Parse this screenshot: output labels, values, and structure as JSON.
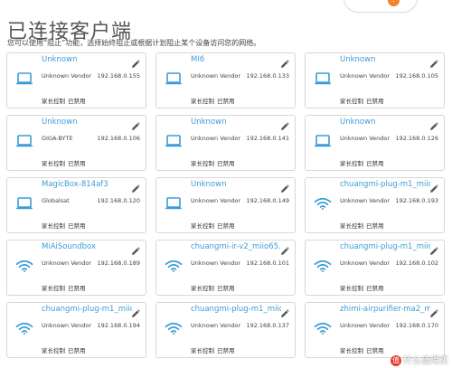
{
  "header": {
    "title": "已连接客户端",
    "notification_count": "!"
  },
  "description": "您可以使用“阻止”功能，选择始终阻止或根据计划阻止某个设备访问您的网络。",
  "labels": {
    "parental_control": "家长控制",
    "disabled": "已禁用"
  },
  "devices": [
    {
      "name": "Unknown",
      "vendor": "Unknown Vendor",
      "ip": "192.168.0.155",
      "type": "wired"
    },
    {
      "name": "MI6",
      "vendor": "Unknown Vendor",
      "ip": "192.168.0.133",
      "type": "wired"
    },
    {
      "name": "Unknown",
      "vendor": "Unknown Vendor",
      "ip": "192.168.0.105",
      "type": "wired"
    },
    {
      "name": "Unknown",
      "vendor": "GIGA-BYTE",
      "ip": "192.168.0.106",
      "type": "wired"
    },
    {
      "name": "Unknown",
      "vendor": "Unknown Vendor",
      "ip": "192.168.0.141",
      "type": "wired"
    },
    {
      "name": "Unknown",
      "vendor": "Unknown Vendor",
      "ip": "192.168.0.126",
      "type": "wired"
    },
    {
      "name": "MagicBox-814af3",
      "vendor": "Globalsat",
      "ip": "192.168.0.120",
      "type": "wired"
    },
    {
      "name": "Unknown",
      "vendor": "Unknown Vendor",
      "ip": "192.168.0.149",
      "type": "wired"
    },
    {
      "name": "chuangmi-plug-m1_miio...",
      "vendor": "Unknown Vendor",
      "ip": "192.168.0.193",
      "type": "wifi"
    },
    {
      "name": "MiAiSoundbox",
      "vendor": "Unknown Vendor",
      "ip": "192.168.0.189",
      "type": "wifi"
    },
    {
      "name": "chuangmi-ir-v2_miio65...",
      "vendor": "Unknown Vendor",
      "ip": "192.168.0.101",
      "type": "wifi"
    },
    {
      "name": "chuangmi-plug-m1_miio...",
      "vendor": "Unknown Vendor",
      "ip": "192.168.0.102",
      "type": "wifi"
    },
    {
      "name": "chuangmi-plug-m1_miio...",
      "vendor": "Unknown Vendor",
      "ip": "192.168.0.194",
      "type": "wifi"
    },
    {
      "name": "chuangmi-plug-m1_miio...",
      "vendor": "Unknown Vendor",
      "ip": "192.168.0.137",
      "type": "wifi"
    },
    {
      "name": "zhimi-airpurifier-ma2_m...",
      "vendor": "Unknown Vendor",
      "ip": "192.168.0.170",
      "type": "wifi"
    }
  ],
  "watermark": {
    "logo_text": "值",
    "text": "什么值得买"
  },
  "colors": {
    "accent": "#3c9dd6",
    "border": "#d7d7d7",
    "badge": "#f5822a"
  }
}
